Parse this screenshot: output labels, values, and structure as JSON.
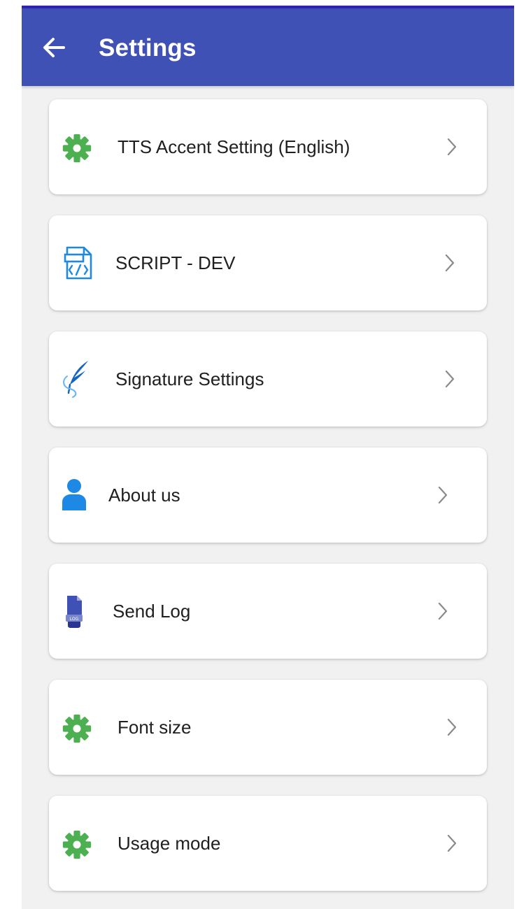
{
  "header": {
    "title": "Settings",
    "back_icon": "arrow-left-icon",
    "background": "#3f51b5",
    "title_color": "#ffffff"
  },
  "settings": {
    "items": [
      {
        "label": "TTS Accent Setting (English)",
        "icon": "gear-icon",
        "icon_color": "#4caf50"
      },
      {
        "label": "SCRIPT - DEV",
        "icon": "code-file-icon",
        "icon_color": "#1e88e5"
      },
      {
        "label": "Signature Settings",
        "icon": "feather-pen-icon",
        "icon_color": "#1565c0"
      },
      {
        "label": "About us",
        "icon": "user-icon",
        "icon_color": "#1e88e5"
      },
      {
        "label": "Send Log",
        "icon": "log-file-icon",
        "icon_color": "#3f51b5"
      },
      {
        "label": "Font size",
        "icon": "gear-icon",
        "icon_color": "#4caf50"
      },
      {
        "label": "Usage mode",
        "icon": "gear-icon",
        "icon_color": "#4caf50"
      }
    ]
  },
  "theme": {
    "background": "#f1f1f1",
    "card": "#ffffff",
    "chevron_color": "#8a8a8a"
  }
}
